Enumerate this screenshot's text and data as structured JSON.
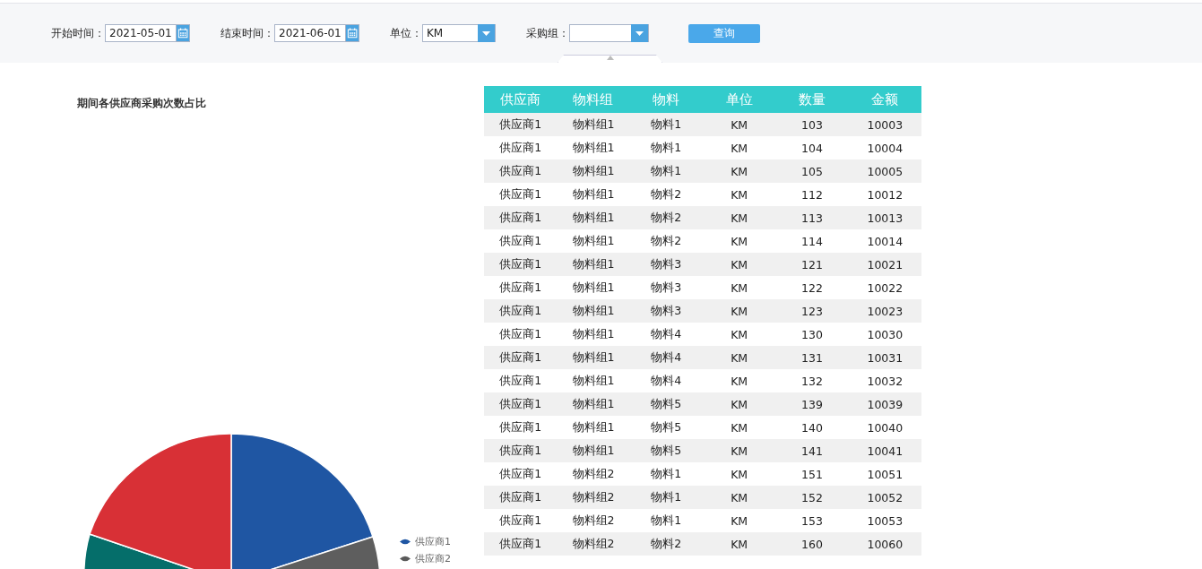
{
  "filters": [
    {
      "kind": "date",
      "label": "开始时间：",
      "value": "2021-05-01"
    },
    {
      "kind": "date",
      "label": "结束时间：",
      "value": "2021-06-01"
    },
    {
      "kind": "select",
      "label": "单位：",
      "value": "KM"
    },
    {
      "kind": "select",
      "label": "采购组："
    }
  ],
  "query_button": "查询",
  "chart": {
    "title": "期间各供应商采购次数占比",
    "legend": [
      {
        "label": "供应商1",
        "color": "#1f56a3"
      },
      {
        "label": "供应商2",
        "color": "#5a5a5a"
      }
    ]
  },
  "table": {
    "columns": [
      "供应商",
      "物料组",
      "物料",
      "单位",
      "数量",
      "金额"
    ],
    "rows": [
      [
        "供应商1",
        "物料组1",
        "物料1",
        "KM",
        "103",
        "10003"
      ],
      [
        "供应商1",
        "物料组1",
        "物料1",
        "KM",
        "104",
        "10004"
      ],
      [
        "供应商1",
        "物料组1",
        "物料1",
        "KM",
        "105",
        "10005"
      ],
      [
        "供应商1",
        "物料组1",
        "物料2",
        "KM",
        "112",
        "10012"
      ],
      [
        "供应商1",
        "物料组1",
        "物料2",
        "KM",
        "113",
        "10013"
      ],
      [
        "供应商1",
        "物料组1",
        "物料2",
        "KM",
        "114",
        "10014"
      ],
      [
        "供应商1",
        "物料组1",
        "物料3",
        "KM",
        "121",
        "10021"
      ],
      [
        "供应商1",
        "物料组1",
        "物料3",
        "KM",
        "122",
        "10022"
      ],
      [
        "供应商1",
        "物料组1",
        "物料3",
        "KM",
        "123",
        "10023"
      ],
      [
        "供应商1",
        "物料组1",
        "物料4",
        "KM",
        "130",
        "10030"
      ],
      [
        "供应商1",
        "物料组1",
        "物料4",
        "KM",
        "131",
        "10031"
      ],
      [
        "供应商1",
        "物料组1",
        "物料4",
        "KM",
        "132",
        "10032"
      ],
      [
        "供应商1",
        "物料组1",
        "物料5",
        "KM",
        "139",
        "10039"
      ],
      [
        "供应商1",
        "物料组1",
        "物料5",
        "KM",
        "140",
        "10040"
      ],
      [
        "供应商1",
        "物料组1",
        "物料5",
        "KM",
        "141",
        "10041"
      ],
      [
        "供应商1",
        "物料组2",
        "物料1",
        "KM",
        "151",
        "10051"
      ],
      [
        "供应商1",
        "物料组2",
        "物料1",
        "KM",
        "152",
        "10052"
      ],
      [
        "供应商1",
        "物料组2",
        "物料1",
        "KM",
        "153",
        "10053"
      ],
      [
        "供应商1",
        "物料组2",
        "物料2",
        "KM",
        "160",
        "10060"
      ]
    ]
  }
}
